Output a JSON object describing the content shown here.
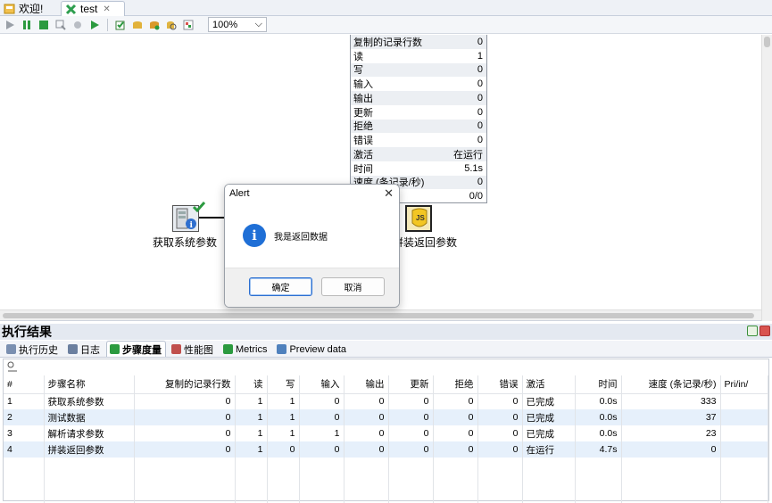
{
  "tabs": [
    {
      "label": "欢迎!",
      "icon": "welcome-icon"
    },
    {
      "label": "test",
      "icon": "transformation-icon"
    }
  ],
  "toolbar": {
    "zoom_value": "100%",
    "icons": [
      "run-icon",
      "pause-icon",
      "stop-icon",
      "preview-icon",
      "debug-icon",
      "replay-icon",
      "verify-icon",
      "impact-icon",
      "sql-icon",
      "explore-db-icon",
      "show-results-icon"
    ]
  },
  "metrics": {
    "rows": [
      {
        "label": "复制的记录行数",
        "value": "0"
      },
      {
        "label": "读",
        "value": "1"
      },
      {
        "label": "写",
        "value": "0"
      },
      {
        "label": "输入",
        "value": "0"
      },
      {
        "label": "输出",
        "value": "0"
      },
      {
        "label": "更新",
        "value": "0"
      },
      {
        "label": "拒绝",
        "value": "0"
      },
      {
        "label": "错误",
        "value": "0"
      },
      {
        "label": "激活",
        "value": "在运行"
      },
      {
        "label": "时间",
        "value": "5.1s"
      },
      {
        "label": "速度 (条记录/秒)",
        "value": "0"
      },
      {
        "label": "",
        "value": "0/0"
      }
    ]
  },
  "nodes": {
    "get_system_params": "获取系统参数",
    "assemble_return_params": "拼装返回参数"
  },
  "alert": {
    "title": "Alert",
    "message": "我是返回数据",
    "ok_label": "确定",
    "cancel_label": "取消"
  },
  "results": {
    "title": "执行结果",
    "subtabs": [
      {
        "label": "执行历史",
        "icon": "history-icon"
      },
      {
        "label": "日志",
        "icon": "log-icon"
      },
      {
        "label": "步骤度量",
        "icon": "step-metrics-icon"
      },
      {
        "label": "性能图",
        "icon": "perf-graph-icon"
      },
      {
        "label": "Metrics",
        "icon": "metrics-icon"
      },
      {
        "label": "Preview data",
        "icon": "preview-data-icon"
      }
    ],
    "columns": [
      "#",
      "步骤名称",
      "复制的记录行数",
      "读",
      "写",
      "输入",
      "输出",
      "更新",
      "拒绝",
      "错误",
      "激活",
      "时间",
      "速度 (条记录/秒)",
      "Pri/in/"
    ],
    "rows": [
      [
        "1",
        "获取系统参数",
        "0",
        "1",
        "1",
        "0",
        "0",
        "0",
        "0",
        "0",
        "已完成",
        "0.0s",
        "333",
        ""
      ],
      [
        "2",
        "测试数据",
        "0",
        "1",
        "1",
        "0",
        "0",
        "0",
        "0",
        "0",
        "已完成",
        "0.0s",
        "37",
        ""
      ],
      [
        "3",
        "解析请求参数",
        "0",
        "1",
        "1",
        "1",
        "0",
        "0",
        "0",
        "0",
        "已完成",
        "0.0s",
        "23",
        ""
      ],
      [
        "4",
        "拼装返回参数",
        "0",
        "1",
        "0",
        "0",
        "0",
        "0",
        "0",
        "0",
        "在运行",
        "4.7s",
        "0",
        ""
      ]
    ]
  }
}
